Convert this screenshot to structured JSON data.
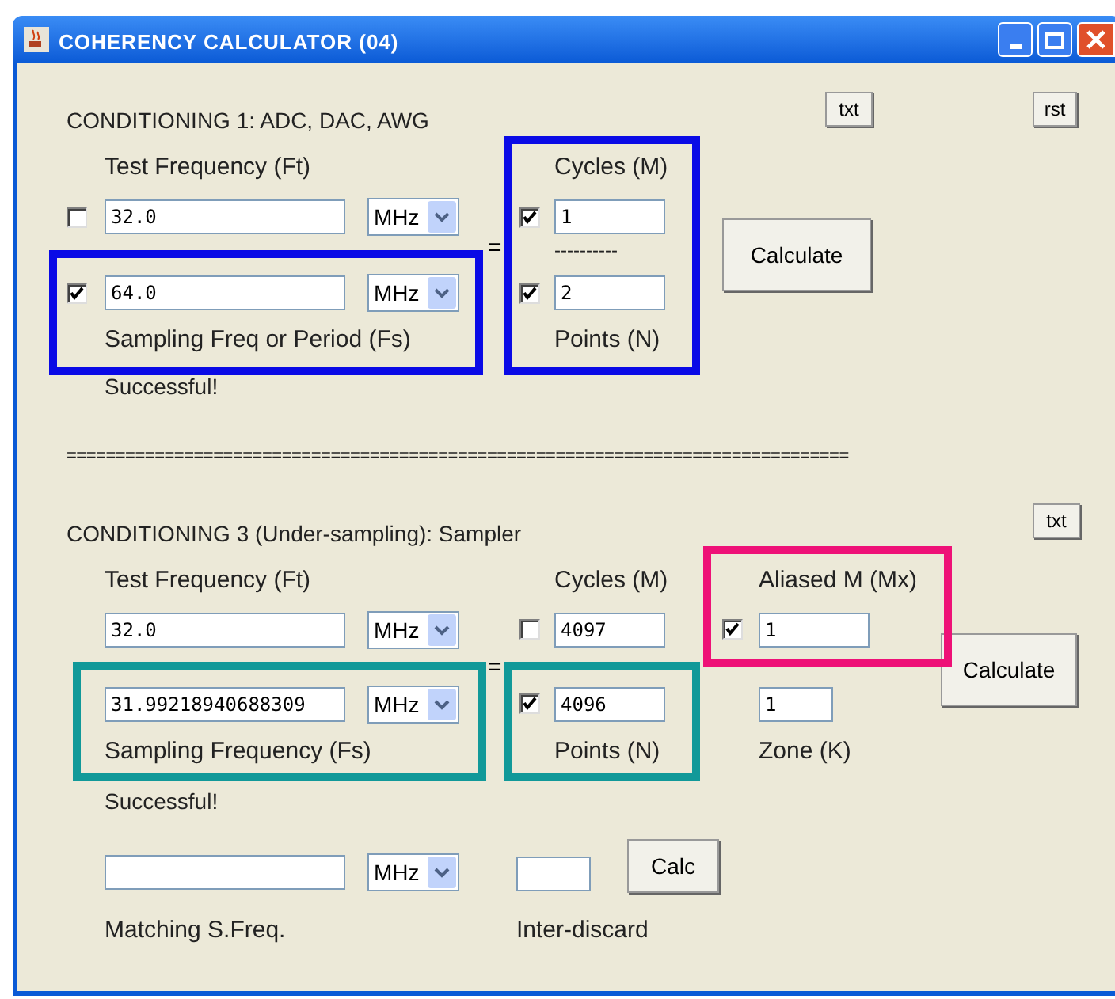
{
  "window": {
    "title": "COHERENCY CALCULATOR (04)"
  },
  "conditioning_1": {
    "heading": "CONDITIONING 1: ADC, DAC, AWG",
    "txt_button": "txt",
    "rst_button": "rst",
    "test_frequency": {
      "label": "Test Frequency (Ft)",
      "checked": false,
      "value": "32.0",
      "unit": "MHz"
    },
    "sampling": {
      "label": "Sampling Freq or Period (Fs)",
      "checked": true,
      "value": "64.0",
      "unit": "MHz"
    },
    "equals": "=",
    "cycles": {
      "label": "Cycles (M)",
      "checked": true,
      "value": "1"
    },
    "divider": "----------",
    "points": {
      "label": "Points (N)",
      "checked": true,
      "value": "2"
    },
    "calculate_button": "Calculate",
    "status": "Successful!"
  },
  "separator": "================================================================================",
  "conditioning_3": {
    "heading": "CONDITIONING 3 (Under-sampling): Sampler",
    "txt_button": "txt",
    "test_frequency": {
      "label": "Test Frequency (Ft)",
      "value": "32.0",
      "unit": "MHz"
    },
    "sampling": {
      "label": "Sampling Frequency (Fs)",
      "value": "31.99218940688309",
      "unit": "MHz"
    },
    "equals": "=",
    "cycles": {
      "label": "Cycles (M)",
      "checked": false,
      "value": "4097"
    },
    "points": {
      "label": "Points (N)",
      "checked": true,
      "value": "4096"
    },
    "aliased": {
      "label": "Aliased M (Mx)",
      "checked": true,
      "value": "1"
    },
    "zone": {
      "label": "Zone (K)",
      "value": "1"
    },
    "calculate_button": "Calculate",
    "status": "Successful!",
    "matching": {
      "label": "Matching S.Freq.",
      "unit": "MHz"
    },
    "inter_discard": {
      "label": "Inter-discard"
    },
    "calc_button": "Calc"
  },
  "highlight_boxes": [
    {
      "color": "#0a0ae6"
    },
    {
      "color": "#0a0ae6"
    },
    {
      "color": "#ee1177"
    },
    {
      "color": "#119999"
    },
    {
      "color": "#119999"
    }
  ]
}
